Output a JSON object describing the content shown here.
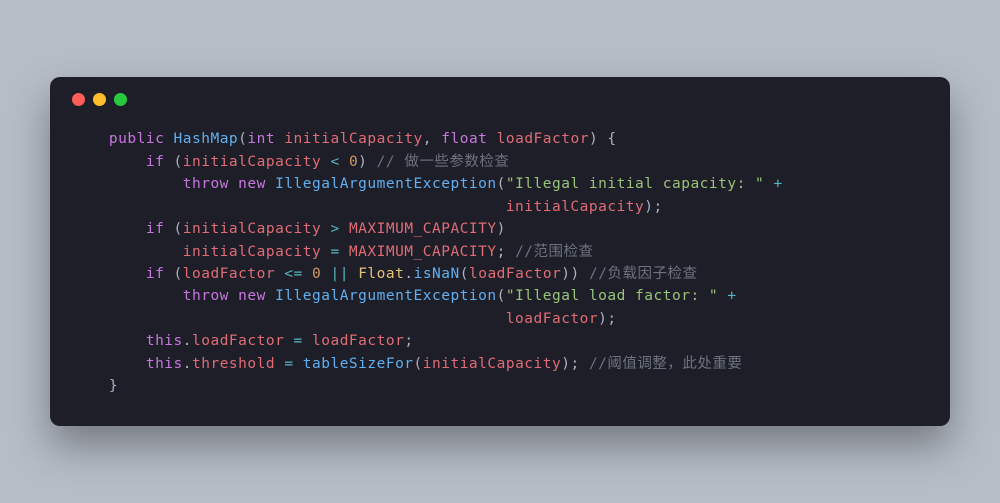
{
  "window": {
    "dots": [
      "red",
      "yellow",
      "green"
    ]
  },
  "code": {
    "l1": {
      "kw_public": "public",
      "cls": "HashMap",
      "p1": "(",
      "kw_int": "int",
      "arg1": "initialCapacity",
      "comma": ",",
      "kw_float": "float",
      "arg2": "loadFactor",
      "p2": ")",
      "brace": "{"
    },
    "l2": {
      "kw_if": "if",
      "p1": "(",
      "var": "initialCapacity",
      "op": "<",
      "num": "0",
      "p2": ")",
      "cmt": "// 做一些参数检查"
    },
    "l3": {
      "kw_throw": "throw",
      "kw_new": "new",
      "cls": "IllegalArgumentException",
      "p1": "(",
      "str": "\"Illegal initial capacity: \"",
      "op": "+"
    },
    "l4": {
      "var": "initialCapacity",
      "p2": ");"
    },
    "l5": {
      "kw_if": "if",
      "p1": "(",
      "var": "initialCapacity",
      "op": ">",
      "const": "MAXIMUM_CAPACITY",
      "p2": ")"
    },
    "l6": {
      "var": "initialCapacity",
      "op": "=",
      "const": "MAXIMUM_CAPACITY",
      "semi": ";",
      "cmt": "//范围检查"
    },
    "l7": {
      "kw_if": "if",
      "p1": "(",
      "var": "loadFactor",
      "op1": "<=",
      "num": "0",
      "op2": "||",
      "cls": "Float",
      "dot": ".",
      "fn": "isNaN",
      "p2": "(",
      "var2": "loadFactor",
      "p3": "))",
      "cmt": "//负载因子检查"
    },
    "l8": {
      "kw_throw": "throw",
      "kw_new": "new",
      "cls": "IllegalArgumentException",
      "p1": "(",
      "str": "\"Illegal load factor: \"",
      "op": "+"
    },
    "l9": {
      "var": "loadFactor",
      "p2": ");"
    },
    "l10": {
      "kw_this": "this",
      "dot": ".",
      "field": "loadFactor",
      "op": "=",
      "var": "loadFactor",
      "semi": ";"
    },
    "l11": {
      "kw_this": "this",
      "dot": ".",
      "field": "threshold",
      "op": "=",
      "fn": "tableSizeFor",
      "p1": "(",
      "arg": "initialCapacity",
      "p2": ");",
      "cmt": "//阈值调整，此处重要"
    },
    "l12": {
      "brace": "}"
    }
  }
}
